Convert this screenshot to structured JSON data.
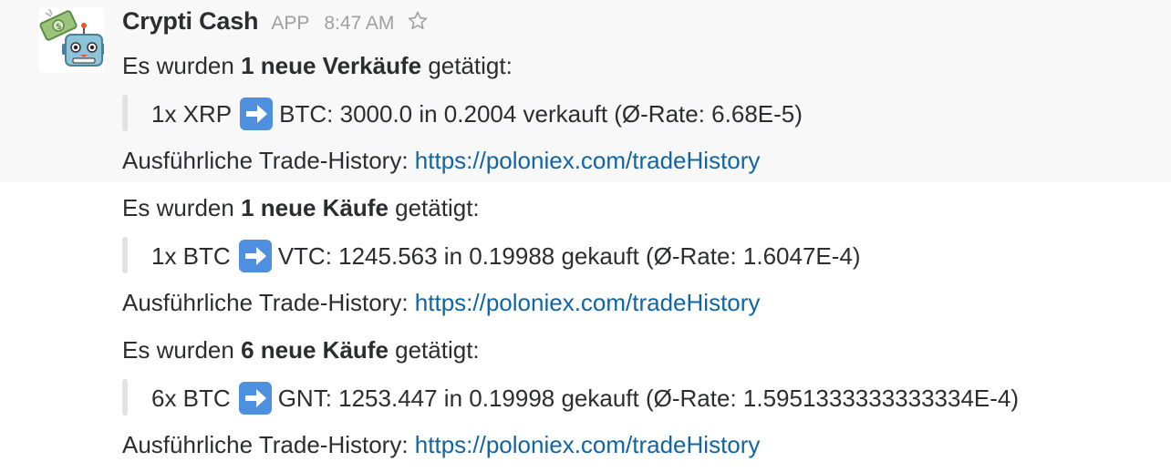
{
  "message": {
    "sender": "Crypti Cash",
    "badge": "APP",
    "time": "8:47 AM",
    "icons": {
      "avatar": "robot-money-emoji-icon",
      "star": "star-outline-icon",
      "arrow": "right-arrow-emoji-icon"
    },
    "colors": {
      "link": "#1264a3",
      "arrow_bg": "#4f8fe0",
      "quote_bar": "#e2e2e2"
    },
    "blocks": [
      {
        "intro_prefix": "Es wurden",
        "intro_bold": "1 neue Verkäufe",
        "intro_suffix": "getätigt:",
        "trade_left": "1x XRP",
        "trade_right": "BTC: 3000.0 in 0.2004 verkauft (Ø-Rate: 6.68E-5)",
        "history_label": "Ausführliche Trade-History:",
        "history_link": "https://poloniex.com/tradeHistory"
      },
      {
        "intro_prefix": "Es wurden",
        "intro_bold": "1 neue Käufe",
        "intro_suffix": "getätigt:",
        "trade_left": "1x BTC",
        "trade_right": "VTC: 1245.563 in 0.19988 gekauft (Ø-Rate: 1.6047E-4)",
        "history_label": "Ausführliche Trade-History:",
        "history_link": "https://poloniex.com/tradeHistory"
      },
      {
        "intro_prefix": "Es wurden",
        "intro_bold": "6 neue Käufe",
        "intro_suffix": "getätigt:",
        "trade_left": "6x BTC",
        "trade_right": "GNT: 1253.447 in 0.19998 gekauft (Ø-Rate: 1.5951333333333334E-4)",
        "history_label": "Ausführliche Trade-History:",
        "history_link": "https://poloniex.com/tradeHistory"
      }
    ]
  }
}
